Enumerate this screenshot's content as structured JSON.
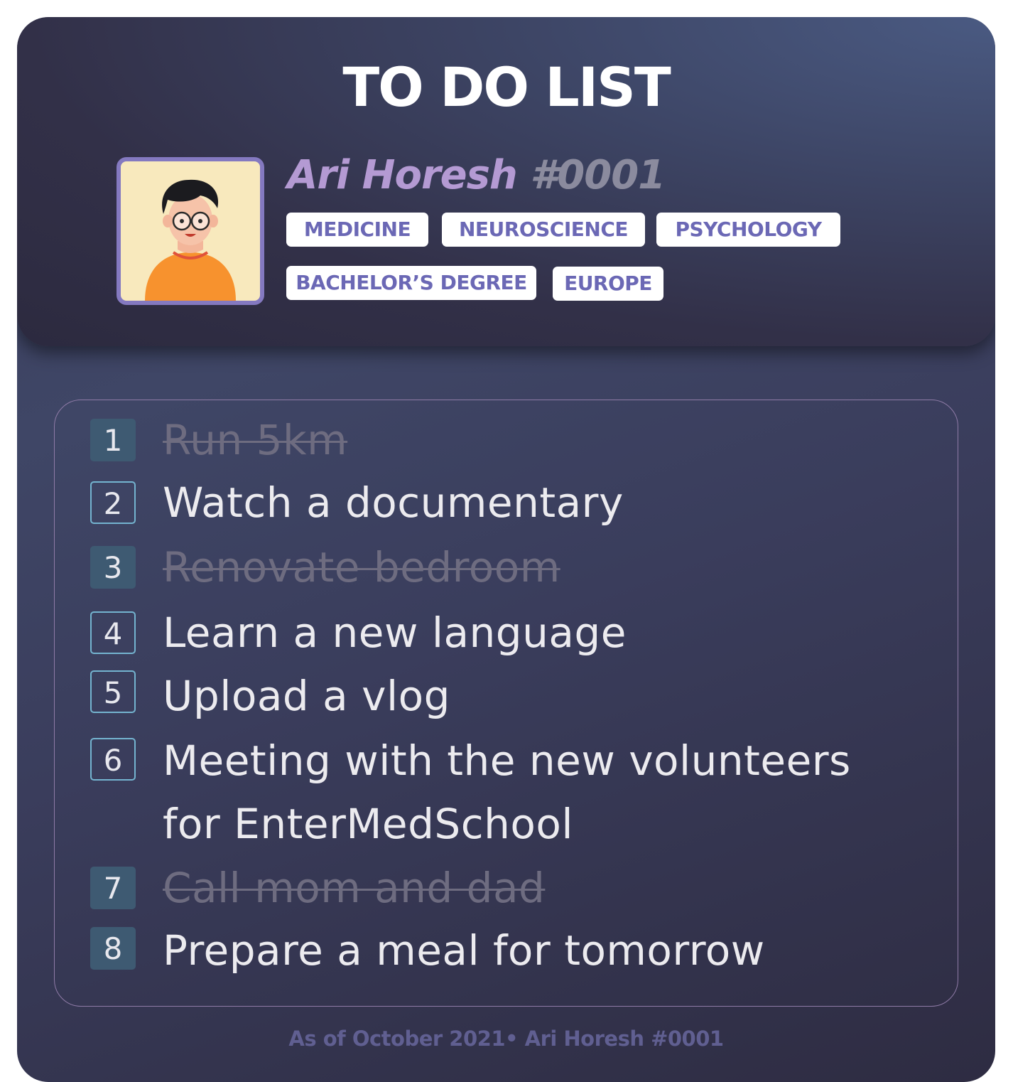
{
  "header": {
    "title": "TO DO LIST",
    "name": "Ari Horesh",
    "tag_number": "#0001",
    "avatar_icon": "person-avatar-icon",
    "tags": [
      "MEDICINE",
      "NEUROSCIENCE",
      "PSYCHOLOGY",
      "BACHELOR’S DEGREE",
      "EUROPE"
    ]
  },
  "tasks": [
    {
      "number": "1",
      "text": "Run 5km",
      "done": true
    },
    {
      "number": "2",
      "text": "Watch a documentary",
      "done": false
    },
    {
      "number": "3",
      "text": "Renovate bedroom",
      "done": true
    },
    {
      "number": "4",
      "text": "Learn a new language",
      "done": false
    },
    {
      "number": "5",
      "text": "Upload a vlog",
      "done": false
    },
    {
      "number": "6",
      "text": "Meeting with the new volunteers",
      "text_line2": "for EnterMedSchool",
      "done": false
    },
    {
      "number": "7",
      "text": "Call mom and dad",
      "done": true
    },
    {
      "number": "8",
      "text": "Prepare a meal for tomorrow",
      "done": true
    }
  ],
  "footer": {
    "text": "As of October 2021• Ari Horesh #0001"
  },
  "colors": {
    "accent_name": "#b49ad3",
    "tag_text": "#6b68b5",
    "done_badge": "#3e5a72",
    "open_badge_border": "#74b4d0",
    "list_border": "#8f7ba7"
  }
}
